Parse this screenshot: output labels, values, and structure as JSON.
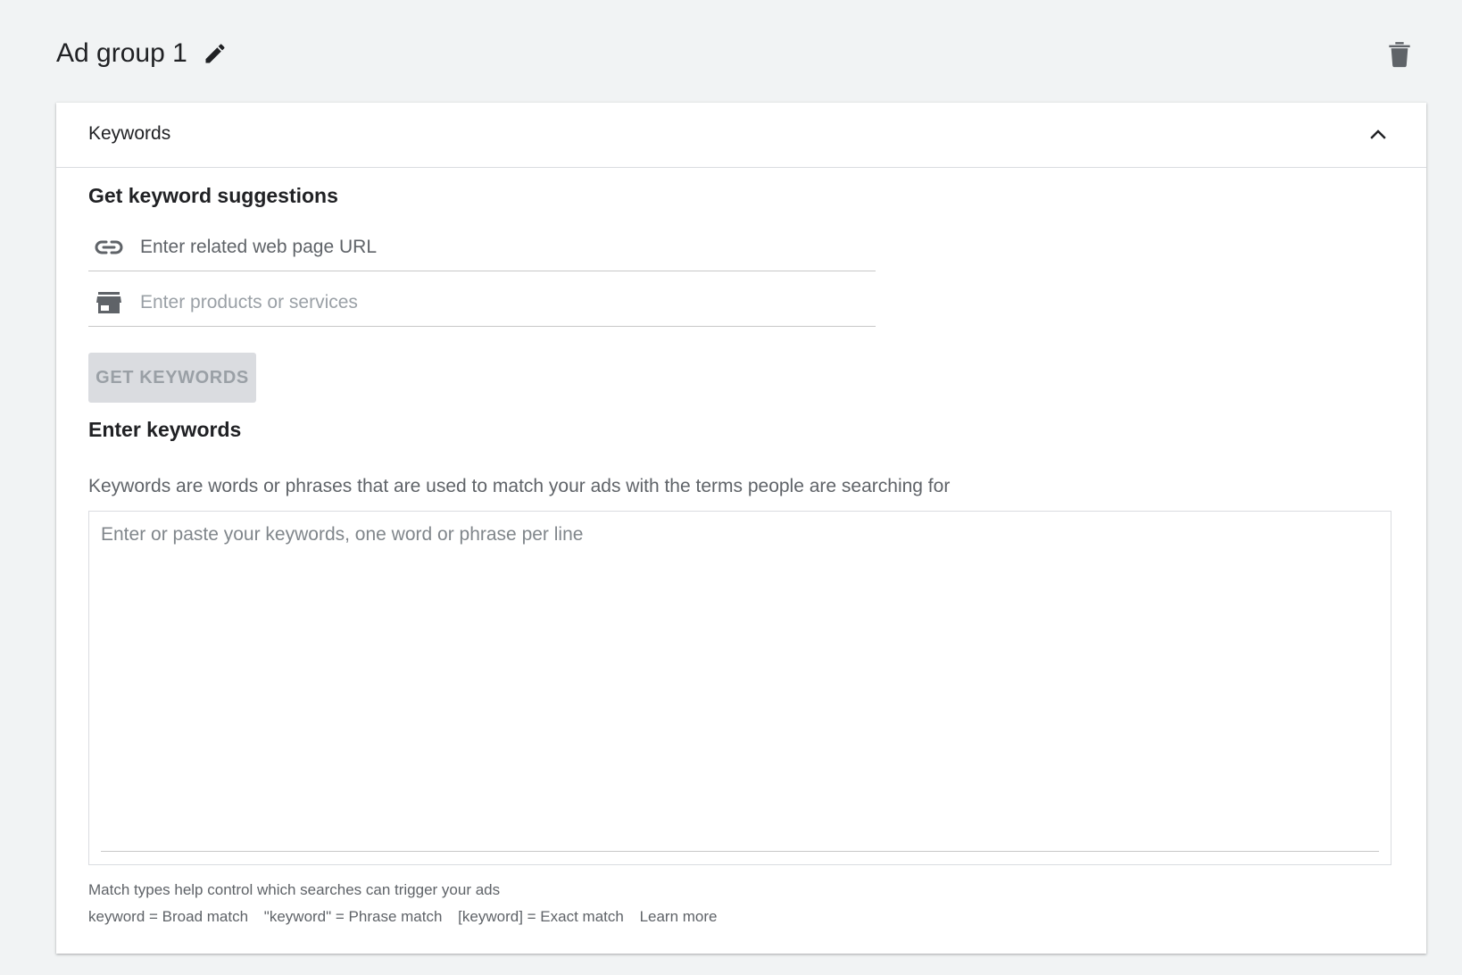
{
  "ad_group": {
    "title": "Ad group 1",
    "edit_icon": "pencil-icon",
    "delete_icon": "trash-icon"
  },
  "keywords_card": {
    "title": "Keywords",
    "collapse_icon": "chevron-up-icon",
    "suggestions": {
      "heading": "Get keyword suggestions",
      "url_placeholder": "Enter related web page URL",
      "url_icon": "link-icon",
      "products_placeholder": "Enter products or services",
      "products_icon": "store-icon",
      "button_label": "GET KEYWORDS"
    },
    "enter": {
      "heading": "Enter keywords",
      "description": "Keywords are words or phrases that are used to match your ads with the terms people are searching for",
      "placeholder": "Enter or paste your keywords, one word or phrase per line"
    },
    "hints": {
      "line1": "Match types help control which searches can trigger your ads",
      "broad": "keyword = Broad match",
      "phrase": "\"keyword\" = Phrase match",
      "exact": "[keyword] = Exact match",
      "learn_more": "Learn more"
    }
  },
  "colors": {
    "background": "#f1f3f4",
    "card": "#ffffff",
    "text": "#202124",
    "secondary_text": "#5f6368",
    "disabled_button": "#dadce0"
  }
}
